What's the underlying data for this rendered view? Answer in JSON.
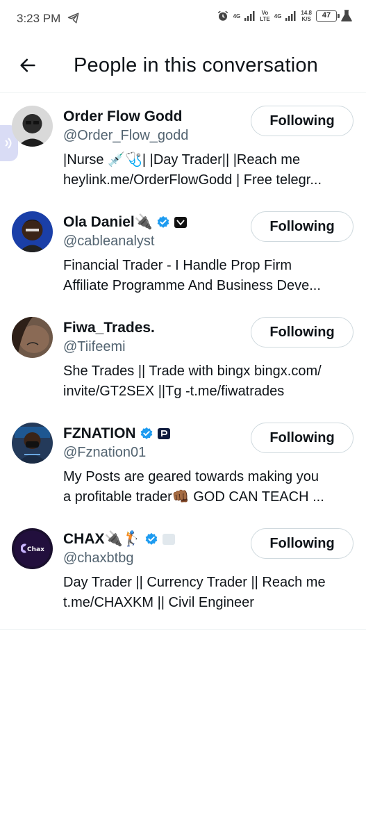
{
  "status_bar": {
    "time": "3:23 PM",
    "net1": "4G",
    "volte_top": "Vo",
    "volte_bottom": "LTE",
    "net2": "4G",
    "speed_top": "14.8",
    "speed_bottom": "K/S",
    "battery": "47"
  },
  "header": {
    "title": "People in this conversation"
  },
  "people": [
    {
      "name": "Order Flow Godd",
      "handle": "@Order_Flow_godd",
      "bio_line1": "|Nurse 💉🩺| |Day Trader|| |Reach me",
      "bio_line2": "heylink.me/OrderFlowGodd | Free telegr...",
      "button": "Following",
      "avatar_color": "#2b2b2b"
    },
    {
      "name": "Ola Daniel🔌",
      "handle": "@cableanalyst",
      "bio_line1": "Financial Trader - I Handle Prop Firm",
      "bio_line2": "Affiliate Programme And Business Deve...",
      "button": "Following",
      "avatar_color": "#1a3fa8"
    },
    {
      "name": "Fiwa_Trades.",
      "handle": "@Tiifeemi",
      "bio_line1": "She Trades || Trade with bingx bingx.com/",
      "bio_line2": "invite/GT2SEX ||Tg -t.me/fiwatrades",
      "button": "Following",
      "avatar_color": "#8a6a55"
    },
    {
      "name": "FZNATION",
      "handle": "@Fznation01",
      "bio_line1": "My Posts are geared towards making you",
      "bio_line2": "a profitable trader👊🏾 GOD CAN TEACH ...",
      "button": "Following",
      "avatar_color": "#243a5a"
    },
    {
      "name": "CHAX🔌🏌",
      "handle": "@chaxbtbg",
      "bio_line1": "Day Trader || Currency Trader || Reach me",
      "bio_line2": "t.me/CHAXKM ||  Civil Engineer",
      "button": "Following",
      "avatar_color": "#1a0f2e",
      "avatar_label": "Chax"
    }
  ],
  "colors": {
    "verified": "#1d9bf0",
    "handle": "#536471",
    "divider": "#eff3f4"
  }
}
